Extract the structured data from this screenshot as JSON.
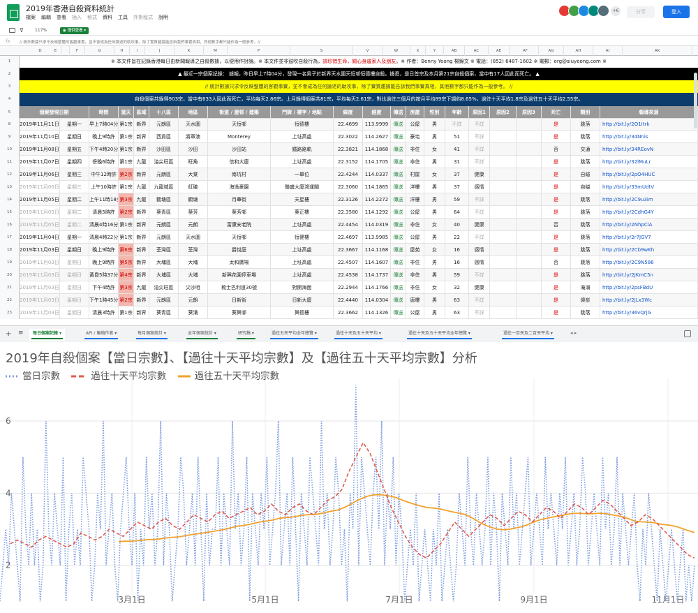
{
  "app": {
    "title": "2019年香港自殺資料統計",
    "menus": [
      {
        "label": "檔案",
        "enabled": true
      },
      {
        "label": "編輯",
        "enabled": true
      },
      {
        "label": "查看",
        "enabled": true
      },
      {
        "label": "插入",
        "enabled": false
      },
      {
        "label": "格式",
        "enabled": false
      },
      {
        "label": "資料",
        "enabled": true
      },
      {
        "label": "工具",
        "enabled": true
      },
      {
        "label": "外掛程式",
        "enabled": false
      },
      {
        "label": "說明",
        "enabled": true
      }
    ],
    "avatar_more": "+6",
    "avatar_colors": [
      "#e53935",
      "#43a047",
      "#1e88e5",
      "#00897b",
      "#546e7a"
    ],
    "share_label": "分享",
    "login_label": "登入"
  },
  "toolbar": {
    "filter_icon": "filter-icon",
    "zoom": "117%",
    "view_only": "僅供查看"
  },
  "formula_bar": {
    "fx": "fx",
    "value": "// 統計數據只求令反映整體的客觀事實，並不會成為任何論述的助攻事，除了實質趨據能告訴我們事實真相，其他數字都只能作為一般參考。//"
  },
  "columns": {
    "letters": [
      "D",
      "E",
      "F",
      "G",
      "H",
      "I",
      "J",
      "K",
      "M",
      "P",
      "S",
      "V",
      "W",
      "X",
      "Y",
      "AB",
      "AC",
      "AE",
      "AF",
      "AG",
      "AH",
      "AI",
      "AK",
      "AM"
    ],
    "headers": [
      "個案發現日期",
      "",
      "時間",
      "當天",
      "區域",
      "十八區",
      "地區",
      "街道 / 屋邨 / 建築",
      "門牌 / 樓字 / 地點",
      "緯度",
      "經度",
      "傳送",
      "房屋",
      "性別",
      "年齡",
      "原因1",
      "原因2",
      "原因3",
      "死亡",
      "類別",
      "報導來源"
    ]
  },
  "banners": {
    "row1": "※ 本文件旨在記錄香港每日由新聞報導之自殺數據，以便用作討論。※ 本文件並非鼓吹自殺行為，",
    "row1_red": "請珍惜生命，關心身邊家人及朋友",
    "row1_tail": "。※ 作者：Benny Yeong 楊錦文 ※ 電話：(852) 6487-1602 ※ 電郵：org@siuyeong.com ※",
    "row2": "▲  最近一宗個案記錄：  據報，昨日早上7時04分，發現一名男子於新界天水圍天恒邨恒德樓自殺。據悉，是日首宗及本月第21宗自殺個案，當中有17人因此而死亡。  ▲",
    "row3": "// 統計數據只求令反映整體的客觀事實，並不會成為任何論述的助攻事，除了實質趨據能告訴我們事實真相，其他數字都只能作為一般參考。 //",
    "row4": "自殺個案共錄得903宗，當中有633人因此而死亡，平均每天2.86宗。上月錄得個案共81宗，平均每天2.61宗，對比過往三個月的按月平均89宗下調約8.65%，過往十天平均1.8宗及過往五十天平均2.55宗。"
  },
  "row_numbers": [
    "1",
    "2",
    "3",
    "4",
    "5",
    "8",
    "9",
    "10",
    "11",
    "12",
    "13",
    "14",
    "15",
    "16",
    "17",
    "18",
    "19",
    "20",
    "21",
    "22",
    "23"
  ],
  "rows": [
    {
      "date": "2019年11月11日",
      "wd": "星期一",
      "time": "早上7時04分",
      "n": "第1宗",
      "reg": "新界",
      "dist": "元朗區",
      "area": "天水圍",
      "street": "天恒邨",
      "place": "恒德樓",
      "lat": "22.4699",
      "lng": "113.9999",
      "send": "傳送",
      "house": "公屋",
      "sex": "男",
      "age": "不詳",
      "r1": "不詳",
      "r2": "",
      "r3": "",
      "dead": "是",
      "cat": "跳落",
      "src": "http://bit.ly/2O1Itrk",
      "grey": false,
      "hl": false
    },
    {
      "date": "2019年11月10日",
      "wd": "星期日",
      "time": "晚上9時許",
      "n": "第1宗",
      "reg": "新界",
      "dist": "西貢區",
      "area": "將軍澳",
      "street": "Monterey",
      "place": "上址高處",
      "lat": "22.3022",
      "lng": "114.2627",
      "send": "傳送",
      "house": "豪宅",
      "sex": "男",
      "age": "51",
      "r1": "不詳",
      "r2": "",
      "r3": "",
      "dead": "是",
      "cat": "跳落",
      "src": "http://bit.ly/34Nnis",
      "grey": false,
      "hl": false
    },
    {
      "date": "2019年11月08日",
      "wd": "星期五",
      "time": "下午4時20分",
      "n": "第1宗",
      "reg": "新界",
      "dist": "沙田區",
      "area": "沙田",
      "street": "沙田站",
      "place": "鐵路路軌",
      "lat": "22.3821",
      "lng": "114.1868",
      "send": "傳送",
      "house": "非住",
      "sex": "女",
      "age": "41",
      "r1": "不詳",
      "r2": "",
      "r3": "",
      "dead": "否",
      "cat": "交通",
      "src": "http://bit.ly/34REovN",
      "grey": false,
      "hl": false
    },
    {
      "date": "2019年11月07日",
      "wd": "星期四",
      "time": "傍晚6時許",
      "n": "第1宗",
      "reg": "九龍",
      "dist": "油尖旺區",
      "area": "旺角",
      "street": "信和大廈",
      "place": "上址高處",
      "lat": "22.3152",
      "lng": "114.1705",
      "send": "傳送",
      "house": "非住",
      "sex": "男",
      "age": "31",
      "r1": "不詳",
      "r2": "",
      "r3": "",
      "dead": "是",
      "cat": "跳落",
      "src": "http://bit.ly/32lMuLr",
      "grey": false,
      "hl": false
    },
    {
      "date": "2019年11月06日",
      "wd": "星期三",
      "time": "中午12時許",
      "n": "第2宗",
      "reg": "新界",
      "dist": "元朗區",
      "area": "大棠",
      "street": "南坑村",
      "place": "一單位",
      "lat": "22.4244",
      "lng": "114.0337",
      "send": "傳送",
      "house": "村屋",
      "sex": "女",
      "age": "37",
      "r1": "健康",
      "r2": "",
      "r3": "",
      "dead": "是",
      "cat": "自縊",
      "src": "http://bit.ly/2pO4HUC",
      "grey": false,
      "hl": true
    },
    {
      "date": "2019年11月06日",
      "wd": "星期三",
      "time": "上午10時許",
      "n": "第1宗",
      "reg": "九龍",
      "dist": "九龍城區",
      "area": "紅磡",
      "street": "海逸豪園",
      "place": "聯盛大廈鴻運閣",
      "lat": "22.3060",
      "lng": "114.1865",
      "send": "傳送",
      "house": "洋樓",
      "sex": "男",
      "age": "37",
      "r1": "感情",
      "r2": "",
      "r3": "",
      "dead": "是",
      "cat": "自縊",
      "src": "http://bit.ly/33mUdtV",
      "grey": true,
      "hl": false
    },
    {
      "date": "2019年11月05日",
      "wd": "星期二",
      "time": "上午11時18分",
      "n": "第3宗",
      "reg": "九龍",
      "dist": "觀塘區",
      "area": "觀塘",
      "street": "月華街",
      "place": "天星樓",
      "lat": "22.3126",
      "lng": "114.2272",
      "send": "傳送",
      "house": "洋樓",
      "sex": "男",
      "age": "59",
      "r1": "不詳",
      "r2": "",
      "r3": "",
      "dead": "是",
      "cat": "跳落",
      "src": "http://bit.ly/2C9u3im",
      "grey": false,
      "hl": true
    },
    {
      "date": "2019年11月05日",
      "wd": "星期二",
      "time": "清晨5時許",
      "n": "第2宗",
      "reg": "新界",
      "dist": "葵青區",
      "area": "葵芳",
      "street": "葵芳邨",
      "place": "葵正樓",
      "lat": "22.3580",
      "lng": "114.1292",
      "send": "傳送",
      "house": "公屋",
      "sex": "男",
      "age": "64",
      "r1": "不詳",
      "r2": "",
      "r3": "",
      "dead": "是",
      "cat": "跳落",
      "src": "http://bit.ly/2CdhG4Y",
      "grey": true,
      "hl": true
    },
    {
      "date": "2019年11月05日",
      "wd": "星期二",
      "time": "清晨4時16分",
      "n": "第1宗",
      "reg": "新界",
      "dist": "元朗區",
      "area": "元朗",
      "street": "富康安老院",
      "place": "上址高處",
      "lat": "22.4454",
      "lng": "114.0319",
      "send": "傳送",
      "house": "非住",
      "sex": "女",
      "age": "40",
      "r1": "健康",
      "r2": "",
      "r3": "",
      "dead": "否",
      "cat": "跳落",
      "src": "http://bit.ly/2NhpClA",
      "grey": true,
      "hl": false
    },
    {
      "date": "2019年11月04日",
      "wd": "星期一",
      "time": "清晨4時22分",
      "n": "第1宗",
      "reg": "新界",
      "dist": "元朗區",
      "area": "天水圍",
      "street": "天恒邨",
      "place": "恒健樓",
      "lat": "22.4697",
      "lng": "113.9985",
      "send": "傳送",
      "house": "公屋",
      "sex": "男",
      "age": "22",
      "r1": "不詳",
      "r2": "",
      "r3": "",
      "dead": "是",
      "cat": "跳落",
      "src": "http://bit.ly/2r7JGV7",
      "grey": false,
      "hl": false
    },
    {
      "date": "2019年11月03日",
      "wd": "星期日",
      "time": "晚上9時許",
      "n": "第6宗",
      "reg": "新界",
      "dist": "荃灣區",
      "area": "荃灣",
      "street": "爵悅庭",
      "place": "上址高處",
      "lat": "22.3667",
      "lng": "114.1168",
      "send": "傳送",
      "house": "屋苑",
      "sex": "女",
      "age": "16",
      "r1": "感情",
      "r2": "",
      "r3": "",
      "dead": "是",
      "cat": "跳落",
      "src": "http://bit.ly/2Cb9wKh",
      "grey": false,
      "hl": true
    },
    {
      "date": "2019年11月03日",
      "wd": "星期日",
      "time": "晚上9時許",
      "n": "第5宗",
      "reg": "新界",
      "dist": "大埔區",
      "area": "大埔",
      "street": "太和廣場",
      "place": "上址高處",
      "lat": "22.4507",
      "lng": "114.1607",
      "send": "傳送",
      "house": "非住",
      "sex": "男",
      "age": "16",
      "r1": "感情",
      "r2": "",
      "r3": "",
      "dead": "否",
      "cat": "跳落",
      "src": "http://bit.ly/2C9N586",
      "grey": true,
      "hl": true
    },
    {
      "date": "2019年11月03日",
      "wd": "星期日",
      "time": "黃昏5時37分",
      "n": "第4宗",
      "reg": "新界",
      "dist": "大埔區",
      "area": "大埔",
      "street": "新興花園停車場",
      "place": "上址高處",
      "lat": "22.4538",
      "lng": "114.1737",
      "send": "傳送",
      "house": "非住",
      "sex": "男",
      "age": "59",
      "r1": "不詳",
      "r2": "",
      "r3": "",
      "dead": "是",
      "cat": "跳落",
      "src": "http://bit.ly/2JKmC5n",
      "grey": true,
      "hl": true
    },
    {
      "date": "2019年11月03日",
      "wd": "星期日",
      "time": "下午4時許",
      "n": "第3宗",
      "reg": "九龍",
      "dist": "油尖旺區",
      "area": "尖沙咀",
      "street": "梳士巴利道30號",
      "place": "對開海面",
      "lat": "22.2944",
      "lng": "114.1766",
      "send": "傳送",
      "house": "非住",
      "sex": "女",
      "age": "32",
      "r1": "健康",
      "r2": "",
      "r3": "",
      "dead": "是",
      "cat": "淹溺",
      "src": "http://bit.ly/2psFBdU",
      "grey": true,
      "hl": true
    },
    {
      "date": "2019年11月03日",
      "wd": "星期日",
      "time": "下午1時45分",
      "n": "第2宗",
      "reg": "新界",
      "dist": "元朗區",
      "area": "元朗",
      "street": "日新街",
      "place": "日新大廈",
      "lat": "22.4440",
      "lng": "114.0304",
      "send": "傳送",
      "house": "唐樓",
      "sex": "男",
      "age": "63",
      "r1": "不詳",
      "r2": "",
      "r3": "",
      "dead": "是",
      "cat": "燒炭",
      "src": "http://bit.ly/2JLx3Wc",
      "grey": true,
      "hl": true
    },
    {
      "date": "2019年11月03日",
      "wd": "星期日",
      "time": "清晨3時許",
      "n": "第1宗",
      "reg": "新界",
      "dist": "葵青區",
      "area": "葵涌",
      "street": "葵興邨",
      "place": "興德樓",
      "lat": "22.3662",
      "lng": "114.1326",
      "send": "傳送",
      "house": "公屋",
      "sex": "男",
      "age": "63",
      "r1": "不詳",
      "r2": "",
      "r3": "",
      "dead": "是",
      "cat": "跳落",
      "src": "http://bit.ly/36vQrjG",
      "grey": true,
      "hl": false
    }
  ],
  "tabs": [
    {
      "label": "每日個案記錄",
      "color": "#188038",
      "active": true
    },
    {
      "label": "API / 聯絡作者",
      "color": "#1a73e8",
      "active": false
    },
    {
      "label": "每月個案統計",
      "color": "#1a73e8",
      "active": false
    },
    {
      "label": "全年個案統計",
      "color": "#188038",
      "active": false
    },
    {
      "label": "研究稿",
      "color": "#188038",
      "active": false
    },
    {
      "label": "過往五天平均全年總覽",
      "color": "#1a73e8",
      "active": false
    },
    {
      "label": "過往十天及五十天平均",
      "color": "#1a73e8",
      "active": false
    },
    {
      "label": "過往十天及五十天平均全年總覽",
      "color": "#1a73e8",
      "active": false
    },
    {
      "label": "過往一百天及二百天平均",
      "color": "#1a73e8",
      "active": false
    }
  ],
  "chart_data": {
    "type": "line",
    "title": "2019年自殺個案【當日宗數】、【過往十天平均宗數】及【過往五十天平均宗數】分析",
    "series": [
      {
        "name": "當日宗數",
        "color": "#7b9ce0",
        "style": "dotted"
      },
      {
        "name": "過往十天平均宗數",
        "color": "#e05a4a",
        "style": "dashed"
      },
      {
        "name": "過往五十天平均宗數",
        "color": "#f2a12b",
        "style": "solid"
      }
    ],
    "x_labels": [
      "3月1日",
      "5月1日",
      "7月1日",
      "9月1日",
      "11月1日"
    ],
    "y_ticks": [
      2,
      4,
      6
    ],
    "ylim": [
      1.2,
      7.2
    ],
    "grid": true,
    "legend": "top-left",
    "daily_counts": [
      1,
      2,
      3,
      2,
      4,
      3,
      2,
      1,
      5,
      3,
      2,
      4,
      2,
      3,
      1,
      2,
      6,
      3,
      2,
      4,
      3,
      2,
      5,
      1,
      3,
      4,
      2,
      3,
      2,
      5,
      4,
      3,
      1,
      2,
      4,
      3,
      6,
      2,
      3,
      4,
      2,
      1,
      3,
      4,
      5,
      3,
      2,
      4,
      1,
      3,
      2,
      5,
      3,
      4,
      2,
      3,
      6,
      2,
      4,
      3,
      1,
      2,
      3,
      5,
      4,
      2,
      3,
      4,
      2,
      5,
      3,
      1,
      4,
      2,
      3,
      3,
      5,
      2,
      4,
      3,
      2,
      6,
      3,
      4,
      2,
      3,
      5,
      1,
      4,
      3,
      2,
      4,
      3,
      5,
      2,
      3,
      4,
      6,
      2,
      3,
      4,
      2,
      5,
      3,
      1,
      4,
      3,
      2,
      5,
      4,
      3,
      2,
      6,
      3,
      4,
      2,
      3,
      5,
      4,
      2,
      3,
      1,
      4,
      3,
      7,
      2,
      5,
      4,
      3,
      2,
      4,
      5,
      3,
      6,
      2,
      4,
      3,
      5,
      2,
      4,
      3,
      1,
      2,
      3,
      2,
      4,
      1,
      2,
      3,
      2,
      1,
      3,
      2,
      4,
      1,
      2,
      3,
      2,
      1,
      2,
      4,
      3,
      2,
      5,
      3,
      2,
      4,
      3,
      2,
      3,
      5,
      2,
      4,
      3,
      1,
      4,
      3,
      2,
      5,
      3,
      4,
      2,
      3,
      4,
      5,
      2,
      3,
      4,
      3,
      2,
      5,
      3,
      4,
      3,
      2,
      4,
      3,
      5,
      2,
      3,
      4,
      2,
      3,
      5,
      4,
      2,
      3,
      4,
      3,
      2,
      5,
      3,
      4,
      2,
      3,
      5,
      2,
      4,
      3,
      2,
      3,
      4,
      2,
      1,
      3,
      2,
      4,
      3,
      2,
      1,
      3,
      2,
      1,
      2,
      3,
      2,
      1,
      2,
      3,
      1,
      2,
      1,
      2
    ],
    "avg10": [
      2.6,
      2.7,
      2.6,
      2.5,
      2.7,
      2.8,
      2.7,
      2.6,
      2.5,
      2.6,
      2.9,
      2.8,
      2.7,
      2.8,
      3.0,
      2.9,
      2.8,
      3.0,
      3.2,
      3.1,
      3.0,
      3.2,
      3.3,
      3.1,
      3.0,
      3.2,
      3.4,
      3.3,
      3.2,
      3.4,
      3.5,
      3.3,
      3.4,
      3.5,
      3.6,
      3.4,
      3.5,
      3.7,
      3.5,
      3.4,
      3.6,
      3.7,
      3.5,
      3.4,
      3.6,
      3.8,
      3.9,
      4.1,
      4.6,
      5.0,
      5.4,
      5.1,
      4.6,
      4.1,
      3.6,
      3.2,
      2.8,
      2.5,
      2.3,
      2.2,
      2.4,
      2.6,
      2.9,
      3.2,
      3.0,
      2.8,
      3.0,
      3.2,
      3.4,
      3.3,
      3.1,
      3.3,
      3.5,
      3.4,
      3.2,
      3.4,
      3.6,
      3.5,
      3.3,
      3.5,
      3.7,
      3.6,
      3.4,
      3.6,
      3.8,
      3.7,
      3.5,
      3.3,
      3.1,
      3.2,
      3.4,
      3.3,
      3.1,
      2.9,
      2.7,
      2.5,
      2.3,
      2.2
    ]
  }
}
